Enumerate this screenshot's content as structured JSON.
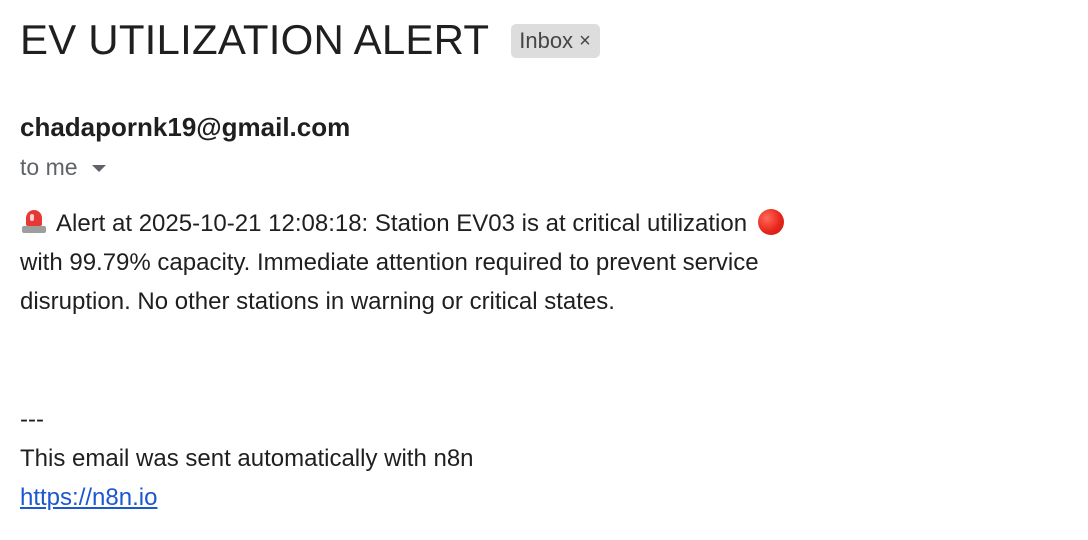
{
  "email": {
    "subject": "EV UTILIZATION ALERT",
    "label": {
      "text": "Inbox",
      "close_glyph": "×"
    },
    "sender": "chadapornk19@gmail.com",
    "recipient": "to me",
    "body": {
      "part1": "Alert at 2025-10-21 12:08:18: Station EV03 is at critical utilization",
      "part2": "with 99.79% capacity. Immediate attention required to prevent service disruption. No other stations in warning or critical states."
    },
    "signature": {
      "divider": "---",
      "line": "This email was sent automatically with n8n",
      "link_text": "https://n8n.io"
    },
    "icons": {
      "alert": "rotating-light-icon",
      "status": "red-circle-icon",
      "recipient_details": "caret-down-icon"
    }
  }
}
